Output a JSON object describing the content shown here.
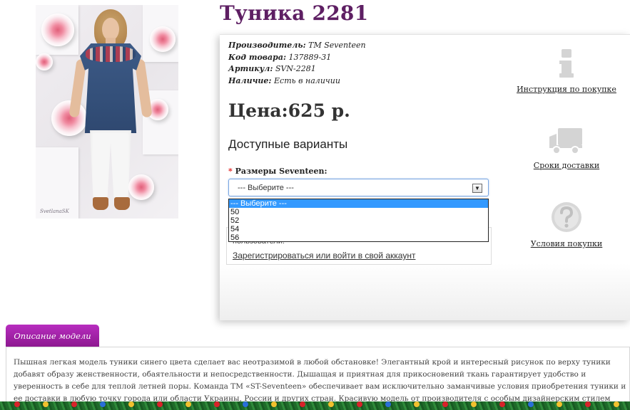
{
  "product": {
    "title": "Туника 2281",
    "photo_signature": "SvetlanaSK"
  },
  "specs": {
    "manufacturer_label": "Производитель:",
    "manufacturer_value": "TM Seventeen",
    "code_label": "Код товара:",
    "code_value": "137889-31",
    "article_label": "Артикул:",
    "article_value": "SVN-2281",
    "availability_label": "Наличие:",
    "availability_value": "Есть в наличии"
  },
  "price": {
    "text": "Цена:625 р."
  },
  "variants": {
    "heading": "Доступные варианты",
    "required_mark": "*",
    "size_label": "Размеры Seventeen:",
    "selected_value": "--- Выберите ---",
    "options": [
      "--- Выберите ---",
      "50",
      "52",
      "54",
      "56"
    ],
    "highlighted_option_index": 0
  },
  "auth": {
    "text": "пользователи!",
    "link": "Зарегистрироваться или войти в свой аккаунт"
  },
  "aside": {
    "instructions_label": "Инструкция по покупке",
    "instructions_icon": "info-icon",
    "delivery_label": "Сроки доставки",
    "delivery_icon": "truck-icon",
    "terms_label": "Условия покупки",
    "terms_icon": "question-icon"
  },
  "description": {
    "tab_label": "Описание модели",
    "text": "Пышная легкая модель туники синего цвета сделает вас неотразимой в любой обстановке! Элегантный крой и интересный рисунок по верху туники добавят образу женственности, обаятельности и непосредственности. Дышащая и приятная для прикосновений ткань гарантирует удобство и уверенность в себе для теплой летней поры. Команда ТМ «ST-Seventeen» обеспечивает вам исключительно заманчивые условия приобретения туники и ее доставки в любую точку города или области Украины, России и других стран. Красивую модель от производителя с особым дизайнерским стилем можно заказать в розницу по"
  },
  "colors": {
    "title": "#5e1f63",
    "tab": "#a024a8",
    "select_border": "#7aa7e2",
    "option_highlight": "#3399ff",
    "required": "#e02020"
  }
}
